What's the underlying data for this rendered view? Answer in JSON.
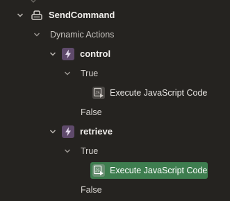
{
  "tree": {
    "region": {
      "label": "SendCommand",
      "icon": "region-icon"
    },
    "group_label": "Dynamic Actions",
    "actions": [
      {
        "name": "control",
        "icon": "dynamic-action-icon",
        "true_label": "True",
        "action_label": "Execute JavaScript Code",
        "action_icon": "javascript-icon",
        "false_label": "False",
        "selected": false
      },
      {
        "name": "retrieve",
        "icon": "dynamic-action-icon",
        "true_label": "True",
        "action_label": "Execute JavaScript Code",
        "action_icon": "javascript-icon",
        "false_label": "False",
        "selected": true
      }
    ]
  },
  "colors": {
    "background": "#252320",
    "selected": "#3e7d4f",
    "dynamic_action_icon": "#5f4a6b"
  }
}
